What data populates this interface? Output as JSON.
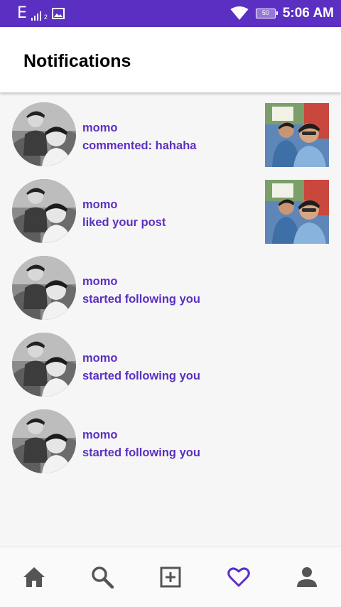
{
  "status_bar": {
    "network_label": "E",
    "network_sub": "2",
    "battery_level": "50",
    "time": "5:06 AM",
    "icons": [
      "signal-icon",
      "image-icon",
      "wifi-icon",
      "battery-icon"
    ],
    "background_color": "#5b2fc2"
  },
  "header": {
    "title": "Notifications"
  },
  "notifications": [
    {
      "username": "momo",
      "message": "commented:  hahaha",
      "has_post_thumbnail": true
    },
    {
      "username": "momo",
      "message": "liked your post",
      "has_post_thumbnail": true
    },
    {
      "username": "momo",
      "message": "started following you",
      "has_post_thumbnail": false
    },
    {
      "username": "momo",
      "message": "started following you",
      "has_post_thumbnail": false
    },
    {
      "username": "momo",
      "message": "started following you",
      "has_post_thumbnail": false
    }
  ],
  "bottom_nav": {
    "items": [
      {
        "icon": "home-icon",
        "active": false
      },
      {
        "icon": "search-icon",
        "active": false
      },
      {
        "icon": "add-post-icon",
        "active": false
      },
      {
        "icon": "heart-icon",
        "active": true
      },
      {
        "icon": "profile-icon",
        "active": false
      }
    ]
  },
  "colors": {
    "accent": "#5b2fc2",
    "nav_icon": "#555555",
    "background": "#f6f6f6"
  }
}
